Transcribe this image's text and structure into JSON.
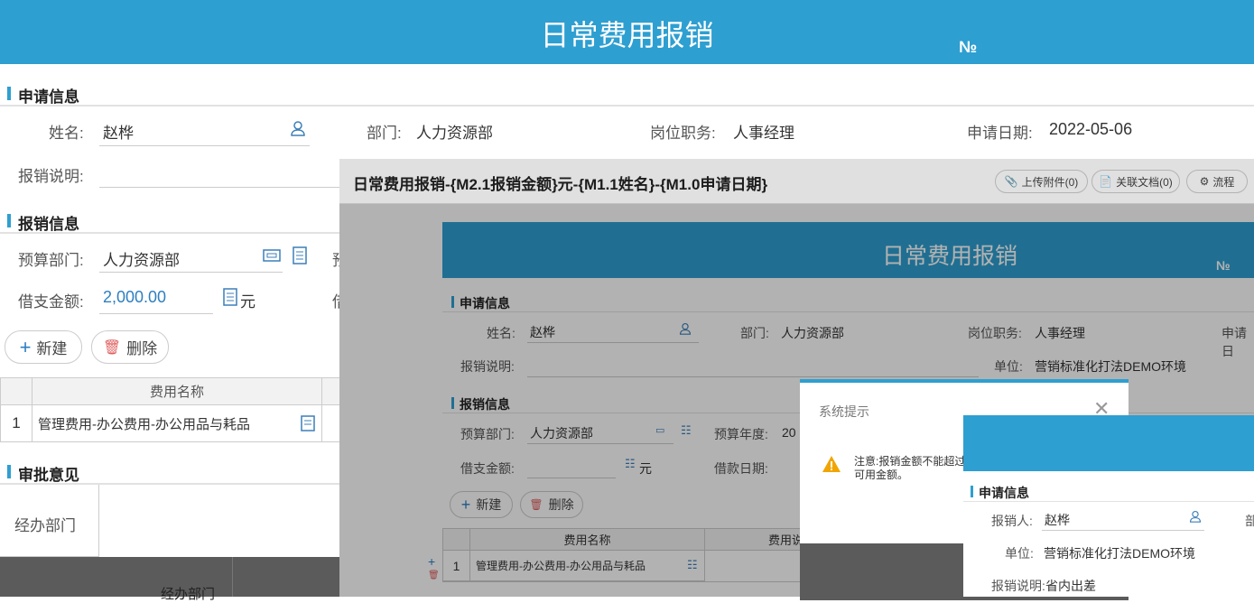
{
  "header": {
    "title": "日常费用报销",
    "no_label": "№"
  },
  "apply_section": {
    "title": "申请信息"
  },
  "apply": {
    "name_label": "姓名:",
    "name_value": "赵桦",
    "dept_label": "部门:",
    "dept_value": "人力资源部",
    "post_label": "岗位职务:",
    "post_value": "人事经理",
    "date_label": "申请日期:",
    "date_value": "2022-05-06",
    "desc_label": "报销说明:"
  },
  "reimb_section": {
    "title": "报销信息"
  },
  "reimb": {
    "budget_dept_label": "预算部门:",
    "budget_dept_value": "人力资源部",
    "borrow_label": "借支金额:",
    "borrow_value": "2,000.00",
    "unit": "元",
    "next_col_1": "预",
    "next_col_2": "借"
  },
  "buttons": {
    "new": "新建",
    "delete": "删除"
  },
  "table": {
    "col_name": "费用名称",
    "rows": [
      {
        "idx": "1",
        "name": "管理费用-办公费用-办公用品与耗品"
      }
    ]
  },
  "approve_section": {
    "title": "审批意见"
  },
  "approve": {
    "dept_label": "经办部门",
    "dark_label": "经办部门"
  },
  "win2": {
    "title": "日常费用报销-{M2.1报销金额}元-{M1.1姓名}-{M1.0申请日期}",
    "upload": "上传附件(0)",
    "related": "关联文档(0)",
    "flow": "流程"
  },
  "inner": {
    "title": "日常费用报销",
    "no_label": "№",
    "apply_title": "申请信息",
    "name_label": "姓名:",
    "name_value": "赵桦",
    "dept_label": "部门:",
    "dept_value": "人力资源部",
    "post_label": "岗位职务:",
    "post_value": "人事经理",
    "date_partial": "申请日",
    "desc_label": "报销说明:",
    "unit_label": "单位:",
    "unit_value": "营销标准化打法DEMO环境",
    "reimb_title": "报销信息",
    "budget_dept_label": "预算部门:",
    "budget_dept_value": "人力资源部",
    "budget_year_label": "预算年度:",
    "budget_year_value": "20",
    "borrow_label": "借支金额:",
    "yuan": "元",
    "loan_date_label": "借款日期:",
    "new": "新建",
    "delete": "删除",
    "col_name": "费用名称",
    "col_partial": "费用说",
    "row_idx": "1",
    "row_name": "管理费用-办公费用-办公用品与耗品"
  },
  "dialog": {
    "title": "系统提示",
    "message": "注意:报销金额不能超过\n可用金额。"
  },
  "win3": {
    "apply_title": "申请信息",
    "person_label": "报销人:",
    "person_value": "赵桦",
    "unit_label": "单位:",
    "unit_value": "营销标准化打法DEMO环境",
    "desc_label": "报销说明:",
    "desc_value": "省内出差",
    "partial": "部"
  }
}
